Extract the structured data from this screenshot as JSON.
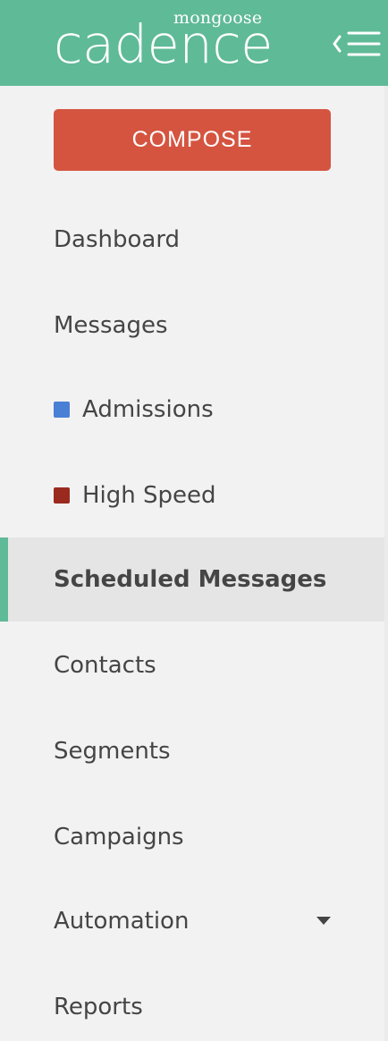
{
  "header": {
    "brand_small": "mongoose",
    "brand_large": "cadence",
    "toggle_icon": "collapse-menu-icon"
  },
  "compose": {
    "label": "COMPOSE"
  },
  "nav": {
    "items": [
      {
        "label": "Dashboard"
      },
      {
        "label": "Messages"
      },
      {
        "label": "Admissions",
        "color": "#4a7fd6"
      },
      {
        "label": "High Speed",
        "color": "#9a2a1e"
      },
      {
        "label": "Scheduled Messages",
        "active": true
      },
      {
        "label": "Contacts"
      },
      {
        "label": "Segments"
      },
      {
        "label": "Campaigns"
      },
      {
        "label": "Automation",
        "icon": "caret-down-icon"
      },
      {
        "label": "Reports"
      }
    ]
  },
  "colors": {
    "header": "#5fba97",
    "compose": "#d55440",
    "active_indicator": "#5fba97"
  }
}
